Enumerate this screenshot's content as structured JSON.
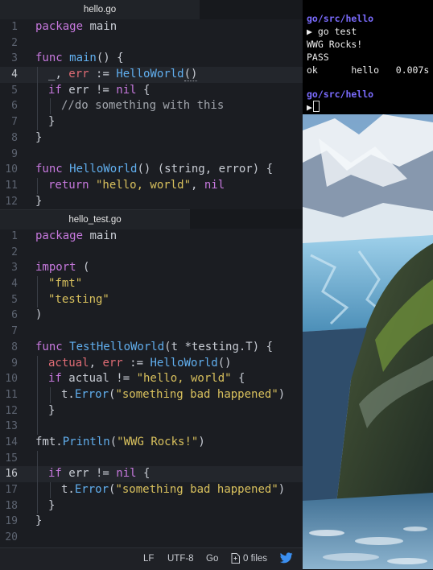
{
  "editor": {
    "tabs": [
      {
        "label": "hello.go"
      },
      {
        "label": "hello_test.go"
      }
    ],
    "hello_go": {
      "lines": [
        {
          "n": "1"
        },
        {
          "n": "2"
        },
        {
          "n": "3"
        },
        {
          "n": "4"
        },
        {
          "n": "5"
        },
        {
          "n": "6"
        },
        {
          "n": "7"
        },
        {
          "n": "8"
        },
        {
          "n": "9"
        },
        {
          "n": "10"
        },
        {
          "n": "11"
        },
        {
          "n": "12"
        }
      ],
      "tokens": {
        "l1_kw": "package",
        "l1_name": " main",
        "l3_kw": "func",
        "l3_fn": " main",
        "l3_rest": "() {",
        "l4_blank": "_",
        "l4_comma": ", ",
        "l4_err": "err",
        "l4_op": " := ",
        "l4_call": "HelloWorld",
        "l4_paren": "()",
        "l5_kw": "if",
        "l5_mid": " err != ",
        "l5_nil": "nil",
        "l5_end": " {",
        "l6_comment": "//do something with this",
        "l7": "}",
        "l8": "}",
        "l10_kw": "func",
        "l10_fn": " HelloWorld",
        "l10_p1": "() (",
        "l10_t1": "string",
        "l10_c": ", ",
        "l10_t2": "error",
        "l10_end": ") {",
        "l11_kw": "return",
        "l11_str": " \"hello, world\"",
        "l11_c": ", ",
        "l11_nil": "nil",
        "l12": "}"
      }
    },
    "hello_test_go": {
      "lines": [
        {
          "n": "1"
        },
        {
          "n": "2"
        },
        {
          "n": "3"
        },
        {
          "n": "4"
        },
        {
          "n": "5"
        },
        {
          "n": "6"
        },
        {
          "n": "7"
        },
        {
          "n": "8"
        },
        {
          "n": "9"
        },
        {
          "n": "10"
        },
        {
          "n": "11"
        },
        {
          "n": "12"
        },
        {
          "n": "13"
        },
        {
          "n": "14"
        },
        {
          "n": "15"
        },
        {
          "n": "16"
        },
        {
          "n": "17"
        },
        {
          "n": "18"
        },
        {
          "n": "19"
        },
        {
          "n": "20"
        }
      ],
      "tokens": {
        "l1_kw": "package",
        "l1_name": " main",
        "l3_kw": "import",
        "l3_rest": " (",
        "l4_str": "\"fmt\"",
        "l5_str": "\"testing\"",
        "l6": ")",
        "l8_kw": "func",
        "l8_fn": " TestHelloWorld",
        "l8_rest": "(t *testing.T) {",
        "l9_var": "actual",
        "l9_c": ", ",
        "l9_err": "err",
        "l9_op": " := ",
        "l9_call": "HelloWorld",
        "l9_paren": "()",
        "l10_kw": "if",
        "l10_mid": " actual != ",
        "l10_str": "\"hello, world\"",
        "l10_end": " {",
        "l11_obj": "t.",
        "l11_call": "Error",
        "l11_p1": "(",
        "l11_str": "\"something bad happened\"",
        "l11_p2": ")",
        "l12": "}",
        "l14_obj": "fmt.",
        "l14_call": "Println",
        "l14_p1": "(",
        "l14_str": "\"WWG Rocks!\"",
        "l14_p2": ")",
        "l16_kw": "if",
        "l16_mid": " err != ",
        "l16_nil": "nil",
        "l16_end": " {",
        "l17_obj": "t.",
        "l17_call": "Error",
        "l17_p1": "(",
        "l17_str": "\"something bad happened\"",
        "l17_p2": ")",
        "l18": "}",
        "l19": "}"
      }
    }
  },
  "statusbar": {
    "line_ending": "LF",
    "encoding": "UTF-8",
    "grammar": "Go",
    "files": "0 files",
    "icons": [
      "file-icon",
      "twitter-bird-icon"
    ]
  },
  "terminal": {
    "prompt_path": "go/src/hello",
    "prompt_symbol": "▶",
    "command": " go test",
    "output1": "WWG Rocks!",
    "output2": "PASS",
    "output3": "ok      hello   0.007s",
    "prompt_path2": "go/src/hello"
  },
  "theme": {
    "keyword": "#c678dd",
    "function": "#61afef",
    "string": "#d8c05d",
    "variable": "#e06c75",
    "terminal_path": "#7b6cff"
  }
}
